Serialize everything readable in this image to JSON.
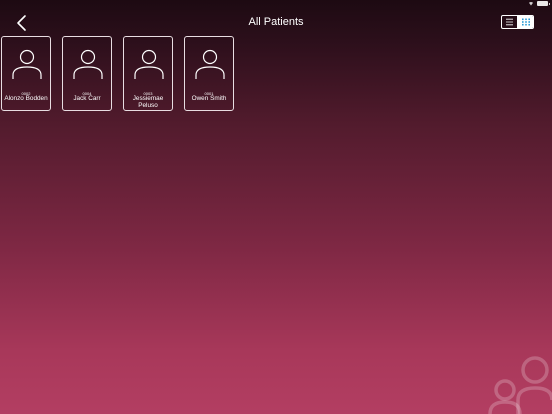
{
  "header": {
    "title": "All Patients"
  },
  "icons": {
    "back": "chevron-left-icon",
    "list_view": "list-icon",
    "grid_view": "grid-icon",
    "avatar": "person-icon",
    "watermark": "people-group-icon"
  },
  "view_toggle": {
    "selected": "grid"
  },
  "patients": [
    {
      "id": "0002",
      "name": "Alonzo Bodden"
    },
    {
      "id": "0004",
      "name": "Jack Carr"
    },
    {
      "id": "0003",
      "name": "Jessiemae Peluso"
    },
    {
      "id": "0001",
      "name": "Owen Smith"
    }
  ],
  "colors": {
    "background_top": "#1d0a12",
    "background_bottom": "#b33e62",
    "accent": "#ffffff"
  }
}
